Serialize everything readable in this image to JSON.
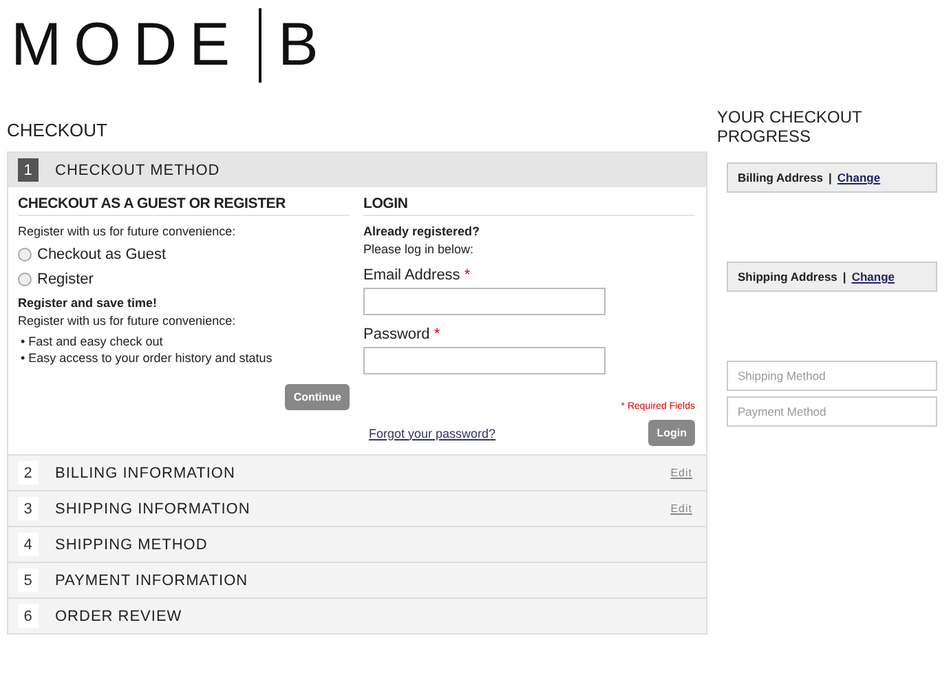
{
  "logo": {
    "left": "MODE",
    "right": "B"
  },
  "page_title": "CHECKOUT",
  "steps": [
    {
      "number": "1",
      "title": "CHECKOUT METHOD",
      "active": true
    },
    {
      "number": "2",
      "title": "BILLING INFORMATION",
      "active": false,
      "edit": "Edit"
    },
    {
      "number": "3",
      "title": "SHIPPING INFORMATION",
      "active": false,
      "edit": "Edit"
    },
    {
      "number": "4",
      "title": "SHIPPING METHOD",
      "active": false
    },
    {
      "number": "5",
      "title": "PAYMENT INFORMATION",
      "active": false
    },
    {
      "number": "6",
      "title": "ORDER REVIEW",
      "active": false
    }
  ],
  "guest": {
    "heading": "CHECKOUT AS A GUEST OR REGISTER",
    "intro": "Register with us for future convenience:",
    "options": [
      {
        "label": "Checkout as Guest",
        "selected": false
      },
      {
        "label": "Register",
        "selected": false
      }
    ],
    "benefit_title": "Register and save time!",
    "benefit_intro": "Register with us for future convenience:",
    "benefits": [
      {
        "bullet": "•",
        "text": "Fast and easy check out"
      },
      {
        "bullet": "•",
        "text": "Easy access to your order history and status"
      }
    ],
    "button": "Continue"
  },
  "login": {
    "heading": "LOGIN",
    "subtitle": "Already registered?",
    "hint": "Please log in below:",
    "fields": [
      {
        "label": "Email Address",
        "required_mark": "*"
      },
      {
        "label": "Password",
        "required_mark": "*"
      }
    ],
    "required_note": "* Required Fields",
    "forgot_link": "Forgot your password?",
    "button": "Login"
  },
  "progress": {
    "title": "YOUR CHECKOUT PROGRESS",
    "items": [
      {
        "kind": "done",
        "label": "Billing Address",
        "separator": "|",
        "link": "Change"
      },
      {
        "kind": "done",
        "label": "Shipping Address",
        "separator": "|",
        "link": "Change"
      },
      {
        "kind": "pending",
        "label": "Shipping Method"
      },
      {
        "kind": "pending",
        "label": "Payment Method"
      }
    ]
  }
}
